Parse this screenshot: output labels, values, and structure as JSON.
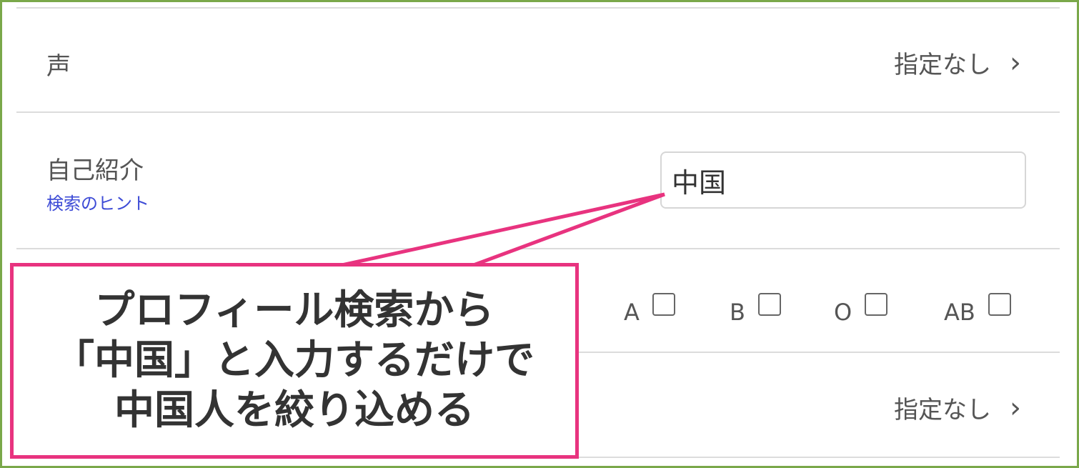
{
  "form": {
    "voice": {
      "label": "声",
      "value": "指定なし"
    },
    "self_intro": {
      "label": "自己紹介",
      "hint_link": "検索のヒント",
      "input_value": "中国"
    },
    "blood_type": {
      "options": [
        "A",
        "B",
        "O",
        "AB"
      ]
    },
    "last_row": {
      "value": "指定なし"
    }
  },
  "callout": {
    "lines": [
      "プロフィール検索から",
      "「中国」と入力するだけで",
      "中国人を絞り込める"
    ]
  },
  "colors": {
    "frame_border": "#7aa84a",
    "callout_border": "#e8337f",
    "hint_link": "#3d4bd6"
  },
  "icons": {
    "row_chevron": "chevron-right-icon"
  }
}
